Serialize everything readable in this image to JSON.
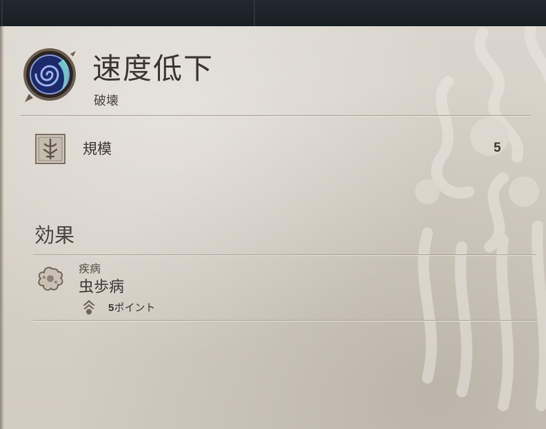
{
  "ability": {
    "title": "速度低下",
    "school": "破壊",
    "icon": "swirl-spell-icon"
  },
  "stats": [
    {
      "label": "規模",
      "value": "5",
      "icon": "scale-rune-icon"
    }
  ],
  "effects_section": {
    "title": "効果",
    "items": [
      {
        "category": "疾病",
        "name": "虫歩病",
        "icon": "disease-splat-icon",
        "points_value": "5",
        "points_unit": "ポイント",
        "points_icon": "point-emblem-icon"
      }
    ]
  },
  "colors": {
    "parchment": "#d6d1c7",
    "ink": "#3b3530",
    "rule": "#a49c90",
    "spell_blue": "#3a4aa8"
  }
}
